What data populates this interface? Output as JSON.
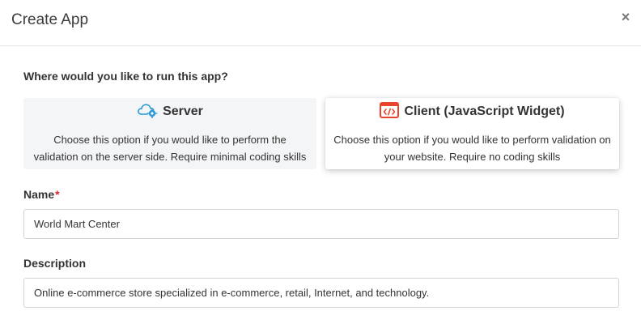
{
  "modal": {
    "title": "Create App",
    "close_label": "×"
  },
  "question": "Where would you like to run this app?",
  "options": [
    {
      "title": "Server",
      "icon": "cloud-gear-icon",
      "description": "Choose this option if you would like to perform the validation on the server side. Require minimal coding skills",
      "selected": false
    },
    {
      "title": "Client (JavaScript Widget)",
      "icon": "code-icon",
      "description": "Choose this option if you would like to perform validation on your website. Require no coding skills",
      "selected": true
    }
  ],
  "name_field": {
    "label": "Name",
    "required_mark": "*",
    "value": "World Mart Center"
  },
  "description_field": {
    "label": "Description",
    "value": "Online e-commerce store specialized in e-commerce, retail, Internet, and technology."
  },
  "colors": {
    "code_icon": "#e8452c",
    "cloud_icon": "#2f9bd6",
    "required": "#d9242b"
  }
}
